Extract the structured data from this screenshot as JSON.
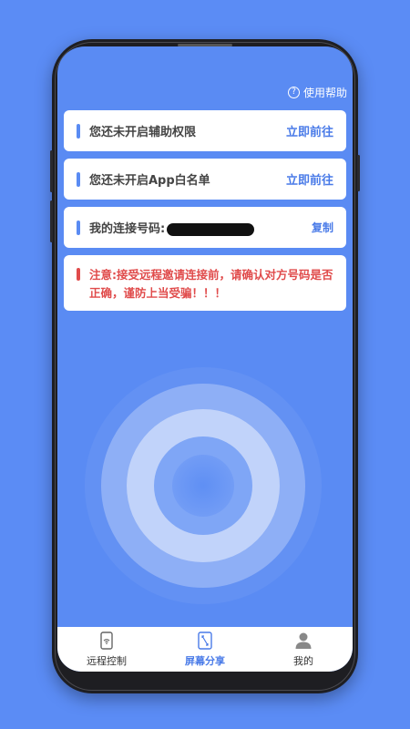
{
  "header": {
    "help_label": "使用帮助",
    "help_icon": "question-circle-icon"
  },
  "cards": {
    "accessibility": {
      "text": "您还未开启辅助权限",
      "action": "立即前往"
    },
    "whitelist": {
      "text": "您还未开启App白名单",
      "action": "立即前往"
    },
    "connection": {
      "label": "我的连接号码:",
      "copy": "复制"
    }
  },
  "warning": {
    "text": "注意:接受远程邀请连接前，请确认对方号码是否正确，谨防上当受骗！！！"
  },
  "tabs": [
    {
      "label": "远程控制",
      "icon": "phone-wifi-icon"
    },
    {
      "label": "屏幕分享",
      "icon": "screen-share-icon"
    },
    {
      "label": "我的",
      "icon": "user-icon"
    }
  ],
  "colors": {
    "accent": "#4a7be8",
    "background": "#5b8cf5",
    "warning": "#e04b4b"
  }
}
